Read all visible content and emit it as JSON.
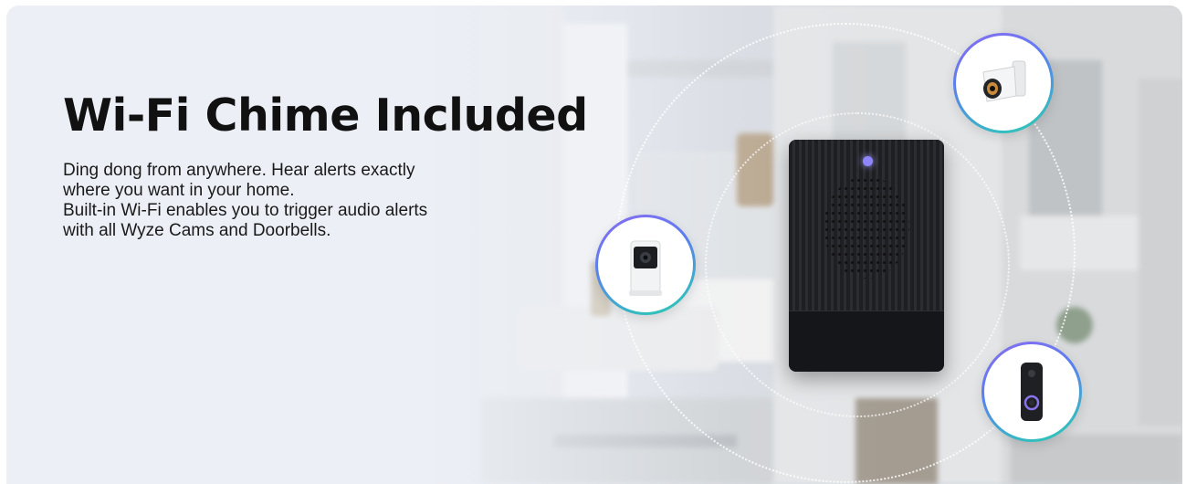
{
  "banner": {
    "headline": "Wi-Fi Chime Included",
    "body_lines": [
      "Ding dong from anywhere. Hear alerts exactly",
      "where you want in your home.",
      "Built-in Wi-Fi enables you to trigger audio alerts",
      "with all Wyze Cams and Doorbells."
    ]
  },
  "colors": {
    "led": "#8f86ff",
    "ring_gradient_start": "#8a6bf0",
    "ring_gradient_end": "#27d0b0"
  },
  "icons": [
    "pan-camera-icon",
    "floodlight-camera-icon",
    "video-doorbell-icon",
    "wifi-chime-device"
  ]
}
